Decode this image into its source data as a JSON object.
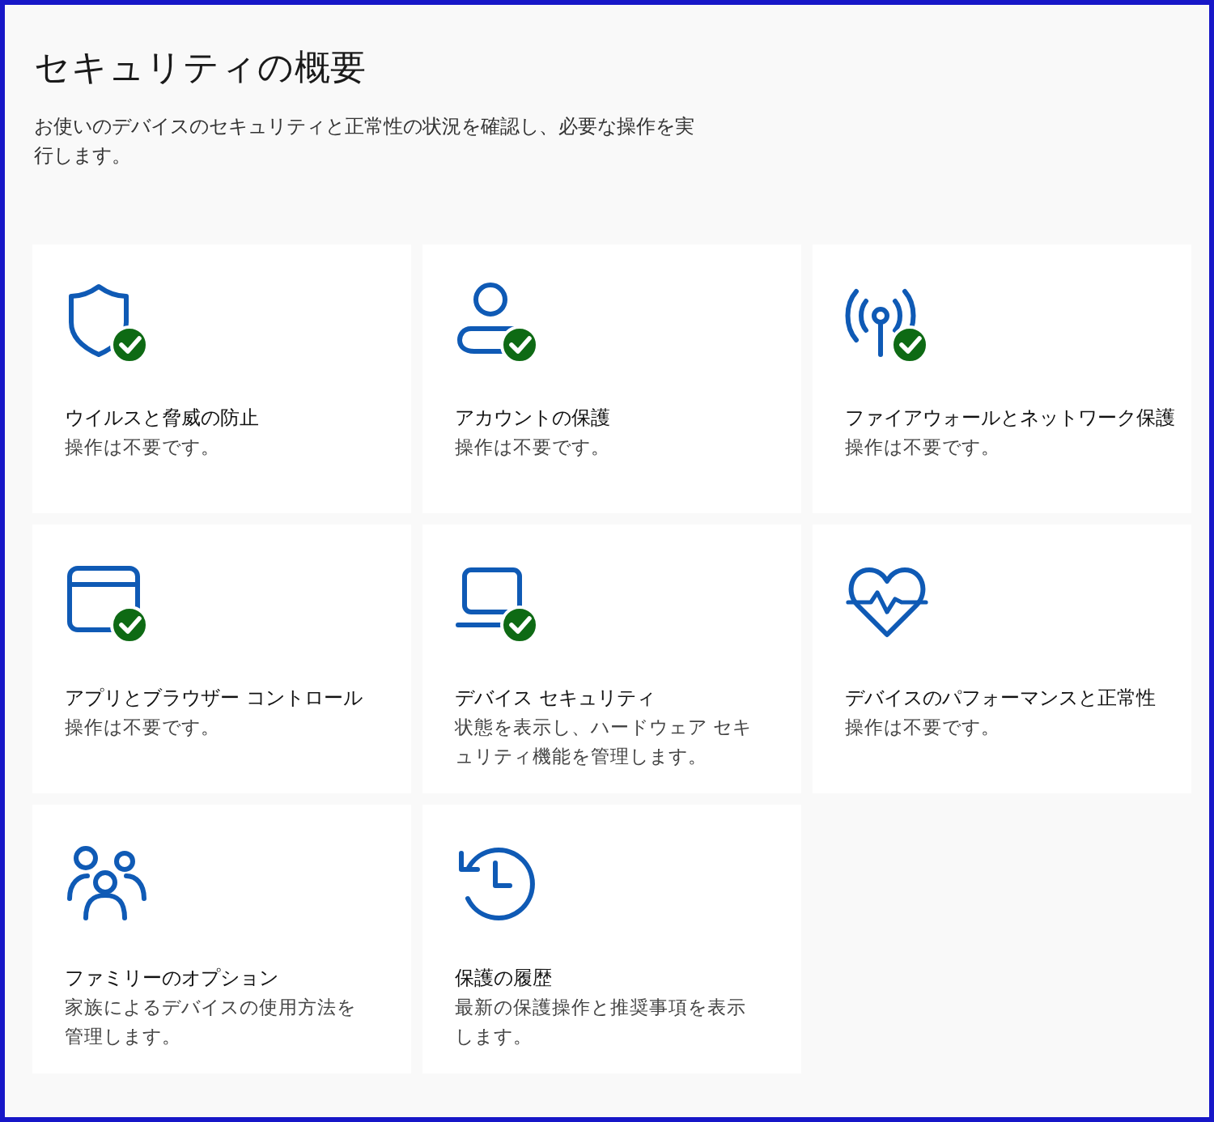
{
  "page": {
    "title": "セキュリティの概要",
    "description": "お使いのデバイスのセキュリティと正常性の状況を確認し、必要な操作を実行します。"
  },
  "cards": [
    {
      "title": "ウイルスと脅威の防止",
      "description": "操作は不要です。",
      "checked": true
    },
    {
      "title": "アカウントの保護",
      "description": "操作は不要です。",
      "checked": true
    },
    {
      "title": "ファイアウォールとネットワーク保護",
      "description": "操作は不要です。",
      "checked": true
    },
    {
      "title": "アプリとブラウザー コントロール",
      "description": "操作は不要です。",
      "checked": true
    },
    {
      "title": "デバイス セキュリティ",
      "description": "状態を表示し、ハードウェア セキュリティ機能を管理します。",
      "checked": true
    },
    {
      "title": "デバイスのパフォーマンスと正常性",
      "description": "操作は不要です。",
      "checked": false
    },
    {
      "title": "ファミリーのオプション",
      "description": "家族によるデバイスの使用方法を管理します。",
      "checked": false
    },
    {
      "title": "保護の履歴",
      "description": "最新の保護操作と推奨事項を表示します。",
      "checked": false
    }
  ]
}
